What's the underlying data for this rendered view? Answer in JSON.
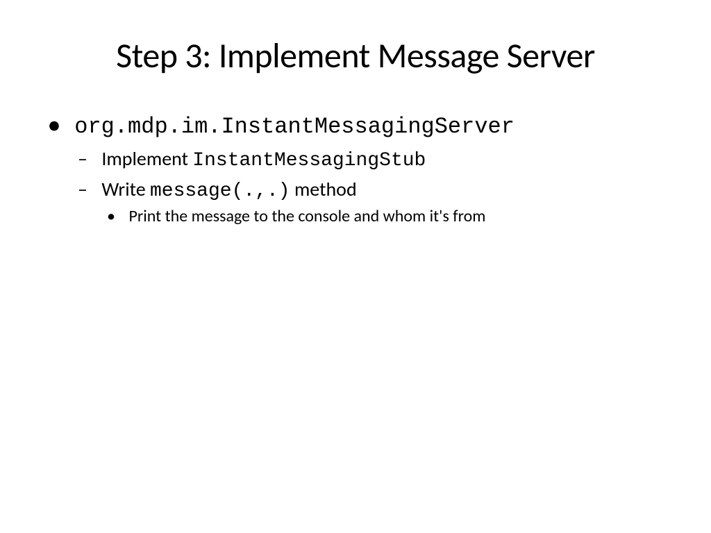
{
  "title": "Step 3: Implement Message Server",
  "bullet1_code": "org.mdp.im.InstantMessagingServer",
  "bullet2_pre": "Implement ",
  "bullet2_code": "InstantMessagingStub",
  "bullet3_pre": "Write ",
  "bullet3_code": "message(.,.)",
  "bullet3_post": " method",
  "bullet4": "Print the message to the console and whom it's from"
}
